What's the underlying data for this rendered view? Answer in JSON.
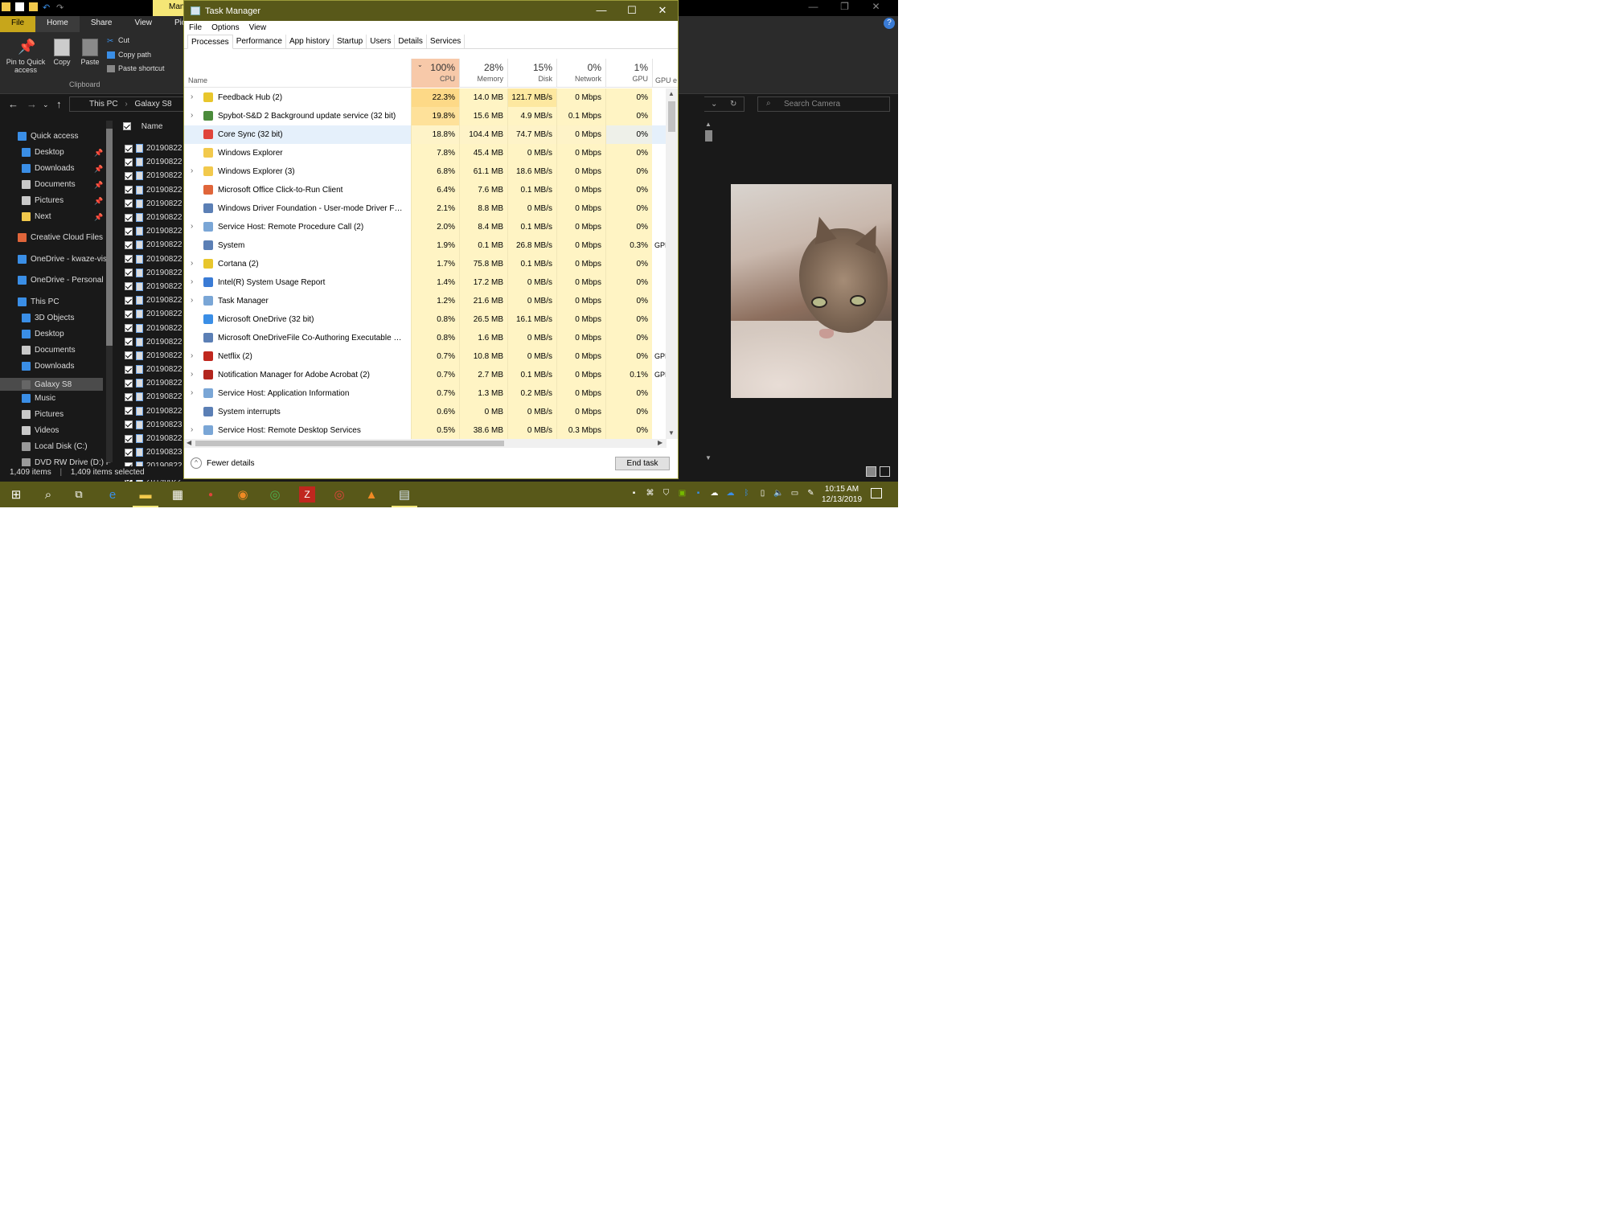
{
  "explorer": {
    "ribbon_tabs": [
      "File",
      "Home",
      "Share",
      "View",
      "Picture"
    ],
    "context_tab": "Man",
    "pin_label": "Pin to Quick access",
    "copy_label": "Copy",
    "paste_label": "Paste",
    "cut_label": "Cut",
    "copy_path_label": "Copy path",
    "paste_shortcut_label": "Paste shortcut",
    "clipboard_group": "Clipboard",
    "breadcrumb": [
      "This PC",
      "Galaxy S8"
    ],
    "search_placeholder": "Search Camera",
    "column_name": "Name",
    "sidebar": [
      {
        "label": "Quick access",
        "color": "#3a8ee6"
      },
      {
        "label": "Desktop",
        "color": "#3a8ee6"
      },
      {
        "label": "Downloads",
        "color": "#3a8ee6"
      },
      {
        "label": "Documents",
        "color": "#c9c9c9"
      },
      {
        "label": "Pictures",
        "color": "#c9c9c9"
      },
      {
        "label": "Next",
        "color": "#f2c94c"
      },
      {
        "label": "Creative Cloud Files",
        "color": "#e0653a"
      },
      {
        "label": "OneDrive - kwaze-vis",
        "color": "#3a8ee6"
      },
      {
        "label": "OneDrive - Personal",
        "color": "#3a8ee6"
      },
      {
        "label": "This PC",
        "color": "#3a8ee6"
      },
      {
        "label": "3D Objects",
        "color": "#3a8ee6"
      },
      {
        "label": "Desktop",
        "color": "#3a8ee6"
      },
      {
        "label": "Documents",
        "color": "#c9c9c9"
      },
      {
        "label": "Downloads",
        "color": "#3a8ee6"
      },
      {
        "label": "Galaxy S8",
        "color": "#666666"
      },
      {
        "label": "Music",
        "color": "#3a8ee6"
      },
      {
        "label": "Pictures",
        "color": "#c9c9c9"
      },
      {
        "label": "Videos",
        "color": "#c9c9c9"
      },
      {
        "label": "Local Disk (C:)",
        "color": "#9a9a9a"
      },
      {
        "label": "DVD RW Drive (D:) F",
        "color": "#9a9a9a"
      }
    ],
    "file_rows": [
      "20190822",
      "20190822",
      "20190822",
      "20190822",
      "20190822",
      "20190822",
      "20190822",
      "20190822",
      "20190822",
      "20190822",
      "20190822",
      "20190822",
      "20190822",
      "20190822",
      "20190822",
      "20190822",
      "20190822",
      "20190822",
      "20190822",
      "20190822",
      "20190823",
      "20190822",
      "20190823",
      "20190822",
      "20190822"
    ],
    "status_items": "1,409 items",
    "status_selected": "1,409 items selected"
  },
  "taskmanager": {
    "title": "Task Manager",
    "menu": [
      "File",
      "Options",
      "View"
    ],
    "tabs": [
      "Processes",
      "Performance",
      "App history",
      "Startup",
      "Users",
      "Details",
      "Services"
    ],
    "name_header": "Name",
    "columns": [
      {
        "pct": "100%",
        "label": "CPU"
      },
      {
        "pct": "28%",
        "label": "Memory"
      },
      {
        "pct": "15%",
        "label": "Disk"
      },
      {
        "pct": "0%",
        "label": "Network"
      },
      {
        "pct": "1%",
        "label": "GPU"
      }
    ],
    "gpu_engine_label": "GPU e",
    "processes": [
      {
        "name": "Feedback Hub (2)",
        "exp": true,
        "icon": "#e8c62c",
        "cpu": "22.3%",
        "mem": "14.0 MB",
        "disk": "121.7 MB/s",
        "net": "0 Mbps",
        "gpu": "0%",
        "gpue": ""
      },
      {
        "name": "Spybot-S&D 2 Background update service (32 bit)",
        "exp": true,
        "icon": "#4b8b3b",
        "cpu": "19.8%",
        "mem": "15.6 MB",
        "disk": "4.9 MB/s",
        "net": "0.1 Mbps",
        "gpu": "0%",
        "gpue": ""
      },
      {
        "name": "Core Sync (32 bit)",
        "exp": false,
        "icon": "#e0443a",
        "cpu": "18.8%",
        "mem": "104.4 MB",
        "disk": "74.7 MB/s",
        "net": "0 Mbps",
        "gpu": "0%",
        "gpue": ""
      },
      {
        "name": "Windows Explorer",
        "exp": false,
        "icon": "#f2c94c",
        "cpu": "7.8%",
        "mem": "45.4 MB",
        "disk": "0 MB/s",
        "net": "0 Mbps",
        "gpu": "0%",
        "gpue": ""
      },
      {
        "name": "Windows Explorer (3)",
        "exp": true,
        "icon": "#f2c94c",
        "cpu": "6.8%",
        "mem": "61.1 MB",
        "disk": "18.6 MB/s",
        "net": "0 Mbps",
        "gpu": "0%",
        "gpue": ""
      },
      {
        "name": "Microsoft Office Click-to-Run Client",
        "exp": false,
        "icon": "#e0653a",
        "cpu": "6.4%",
        "mem": "7.6 MB",
        "disk": "0.1 MB/s",
        "net": "0 Mbps",
        "gpu": "0%",
        "gpue": ""
      },
      {
        "name": "Windows Driver Foundation - User-mode Driver Fra...",
        "exp": false,
        "icon": "#5b7fb5",
        "cpu": "2.1%",
        "mem": "8.8 MB",
        "disk": "0 MB/s",
        "net": "0 Mbps",
        "gpu": "0%",
        "gpue": ""
      },
      {
        "name": "Service Host: Remote Procedure Call (2)",
        "exp": true,
        "icon": "#7aa6d6",
        "cpu": "2.0%",
        "mem": "8.4 MB",
        "disk": "0.1 MB/s",
        "net": "0 Mbps",
        "gpu": "0%",
        "gpue": ""
      },
      {
        "name": "System",
        "exp": false,
        "icon": "#5b7fb5",
        "cpu": "1.9%",
        "mem": "0.1 MB",
        "disk": "26.8 MB/s",
        "net": "0 Mbps",
        "gpu": "0.3%",
        "gpue": "GPI"
      },
      {
        "name": "Cortana (2)",
        "exp": true,
        "icon": "#e8c62c",
        "cpu": "1.7%",
        "mem": "75.8 MB",
        "disk": "0.1 MB/s",
        "net": "0 Mbps",
        "gpu": "0%",
        "gpue": ""
      },
      {
        "name": "Intel(R) System Usage Report",
        "exp": true,
        "icon": "#3a7bd5",
        "cpu": "1.4%",
        "mem": "17.2 MB",
        "disk": "0 MB/s",
        "net": "0 Mbps",
        "gpu": "0%",
        "gpue": ""
      },
      {
        "name": "Task Manager",
        "exp": true,
        "icon": "#7aa6d6",
        "cpu": "1.2%",
        "mem": "21.6 MB",
        "disk": "0 MB/s",
        "net": "0 Mbps",
        "gpu": "0%",
        "gpue": ""
      },
      {
        "name": "Microsoft OneDrive (32 bit)",
        "exp": false,
        "icon": "#3a8ee6",
        "cpu": "0.8%",
        "mem": "26.5 MB",
        "disk": "16.1 MB/s",
        "net": "0 Mbps",
        "gpu": "0%",
        "gpue": ""
      },
      {
        "name": "Microsoft OneDriveFile Co-Authoring Executable (3...",
        "exp": false,
        "icon": "#5b7fb5",
        "cpu": "0.8%",
        "mem": "1.6 MB",
        "disk": "0 MB/s",
        "net": "0 Mbps",
        "gpu": "0%",
        "gpue": ""
      },
      {
        "name": "Netflix (2)",
        "exp": true,
        "icon": "#c0271e",
        "cpu": "0.7%",
        "mem": "10.8 MB",
        "disk": "0 MB/s",
        "net": "0 Mbps",
        "gpu": "0%",
        "gpue": "GPI"
      },
      {
        "name": "Notification Manager for Adobe Acrobat (2)",
        "exp": true,
        "icon": "#b3261e",
        "cpu": "0.7%",
        "mem": "2.7 MB",
        "disk": "0.1 MB/s",
        "net": "0 Mbps",
        "gpu": "0.1%",
        "gpue": "GPI"
      },
      {
        "name": "Service Host: Application Information",
        "exp": true,
        "icon": "#7aa6d6",
        "cpu": "0.7%",
        "mem": "1.3 MB",
        "disk": "0.2 MB/s",
        "net": "0 Mbps",
        "gpu": "0%",
        "gpue": ""
      },
      {
        "name": "System interrupts",
        "exp": false,
        "icon": "#5b7fb5",
        "cpu": "0.6%",
        "mem": "0 MB",
        "disk": "0 MB/s",
        "net": "0 Mbps",
        "gpu": "0%",
        "gpue": ""
      },
      {
        "name": "Service Host: Remote Desktop Services",
        "exp": true,
        "icon": "#7aa6d6",
        "cpu": "0.5%",
        "mem": "38.6 MB",
        "disk": "0 MB/s",
        "net": "0.3 Mbps",
        "gpu": "0%",
        "gpue": ""
      }
    ],
    "fewer_details": "Fewer details",
    "end_task": "End task"
  },
  "taskbar": {
    "time": "10:15 AM",
    "date": "12/13/2019"
  }
}
